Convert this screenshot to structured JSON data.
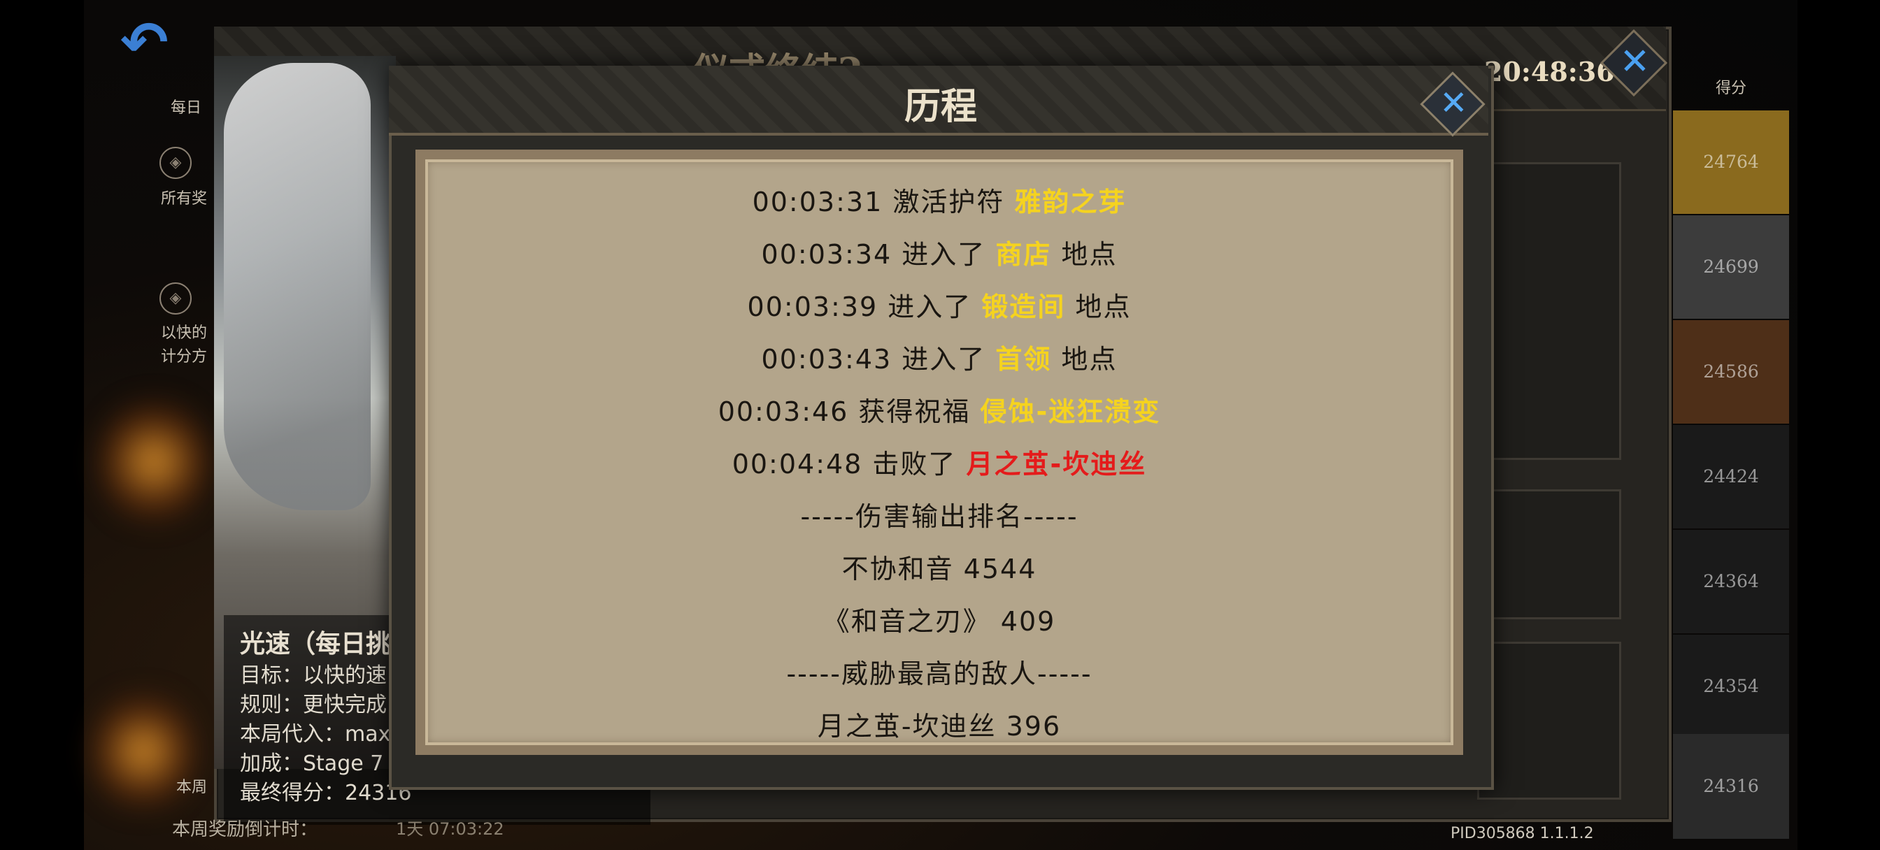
{
  "background": {
    "back_label": "每日",
    "section1_text": "所有奖",
    "section2_text": [
      "以快的",
      "计分方"
    ],
    "outer_title": "仪式终结2",
    "timer": "20:48:36",
    "score_header": "得分",
    "scores": [
      "24764",
      "24699",
      "24586",
      "24424",
      "24364",
      "24354",
      "24316"
    ],
    "score_colors": [
      "#8a6a1e",
      "#3c3c3c",
      "#4e2f18",
      "#1a1a1a",
      "#1a1a1a",
      "#1a1a1a",
      "#2a2a2a"
    ],
    "pid": "PID305868  1.1.1.2",
    "week_left_label": "本周",
    "weekly_countdown_label": "本周奖励倒计时：",
    "weekly_countdown_value": "1天 07:03:22"
  },
  "character_card": {
    "name": "光速（每日挑",
    "lines": [
      "目标：以快的速",
      "规则：更快完成",
      "本局代入：max",
      "加成：Stage 7",
      "最终得分：24316"
    ]
  },
  "modal": {
    "title": "历程",
    "log": [
      {
        "text": "00:03:31 激活护符 ",
        "highlight": "雅韵之芽",
        "tail": "",
        "kind": "hl"
      },
      {
        "text": "00:03:34 进入了 ",
        "highlight": "商店",
        "tail": " 地点",
        "kind": "hl"
      },
      {
        "text": "00:03:39 进入了 ",
        "highlight": "锻造间",
        "tail": " 地点",
        "kind": "hl"
      },
      {
        "text": "00:03:43 进入了 ",
        "highlight": "首领",
        "tail": " 地点",
        "kind": "hl"
      },
      {
        "text": "00:03:46 获得祝福 ",
        "highlight": "侵蚀-迷狂溃变",
        "tail": "",
        "kind": "hl"
      },
      {
        "text": "00:04:48 击败了 ",
        "highlight": "月之茧-坎迪丝",
        "tail": "",
        "kind": "red"
      },
      {
        "text": "-----伤害输出排名-----",
        "highlight": "",
        "tail": "",
        "kind": "plain"
      },
      {
        "text": "不协和音  4544",
        "highlight": "",
        "tail": "",
        "kind": "plain"
      },
      {
        "text": "《和音之刃》  409",
        "highlight": "",
        "tail": "",
        "kind": "plain"
      },
      {
        "text": "-----威胁最高的敌人-----",
        "highlight": "",
        "tail": "",
        "kind": "plain"
      },
      {
        "text": "月之茧-坎迪丝  396",
        "highlight": "",
        "tail": "",
        "kind": "plain"
      }
    ]
  }
}
